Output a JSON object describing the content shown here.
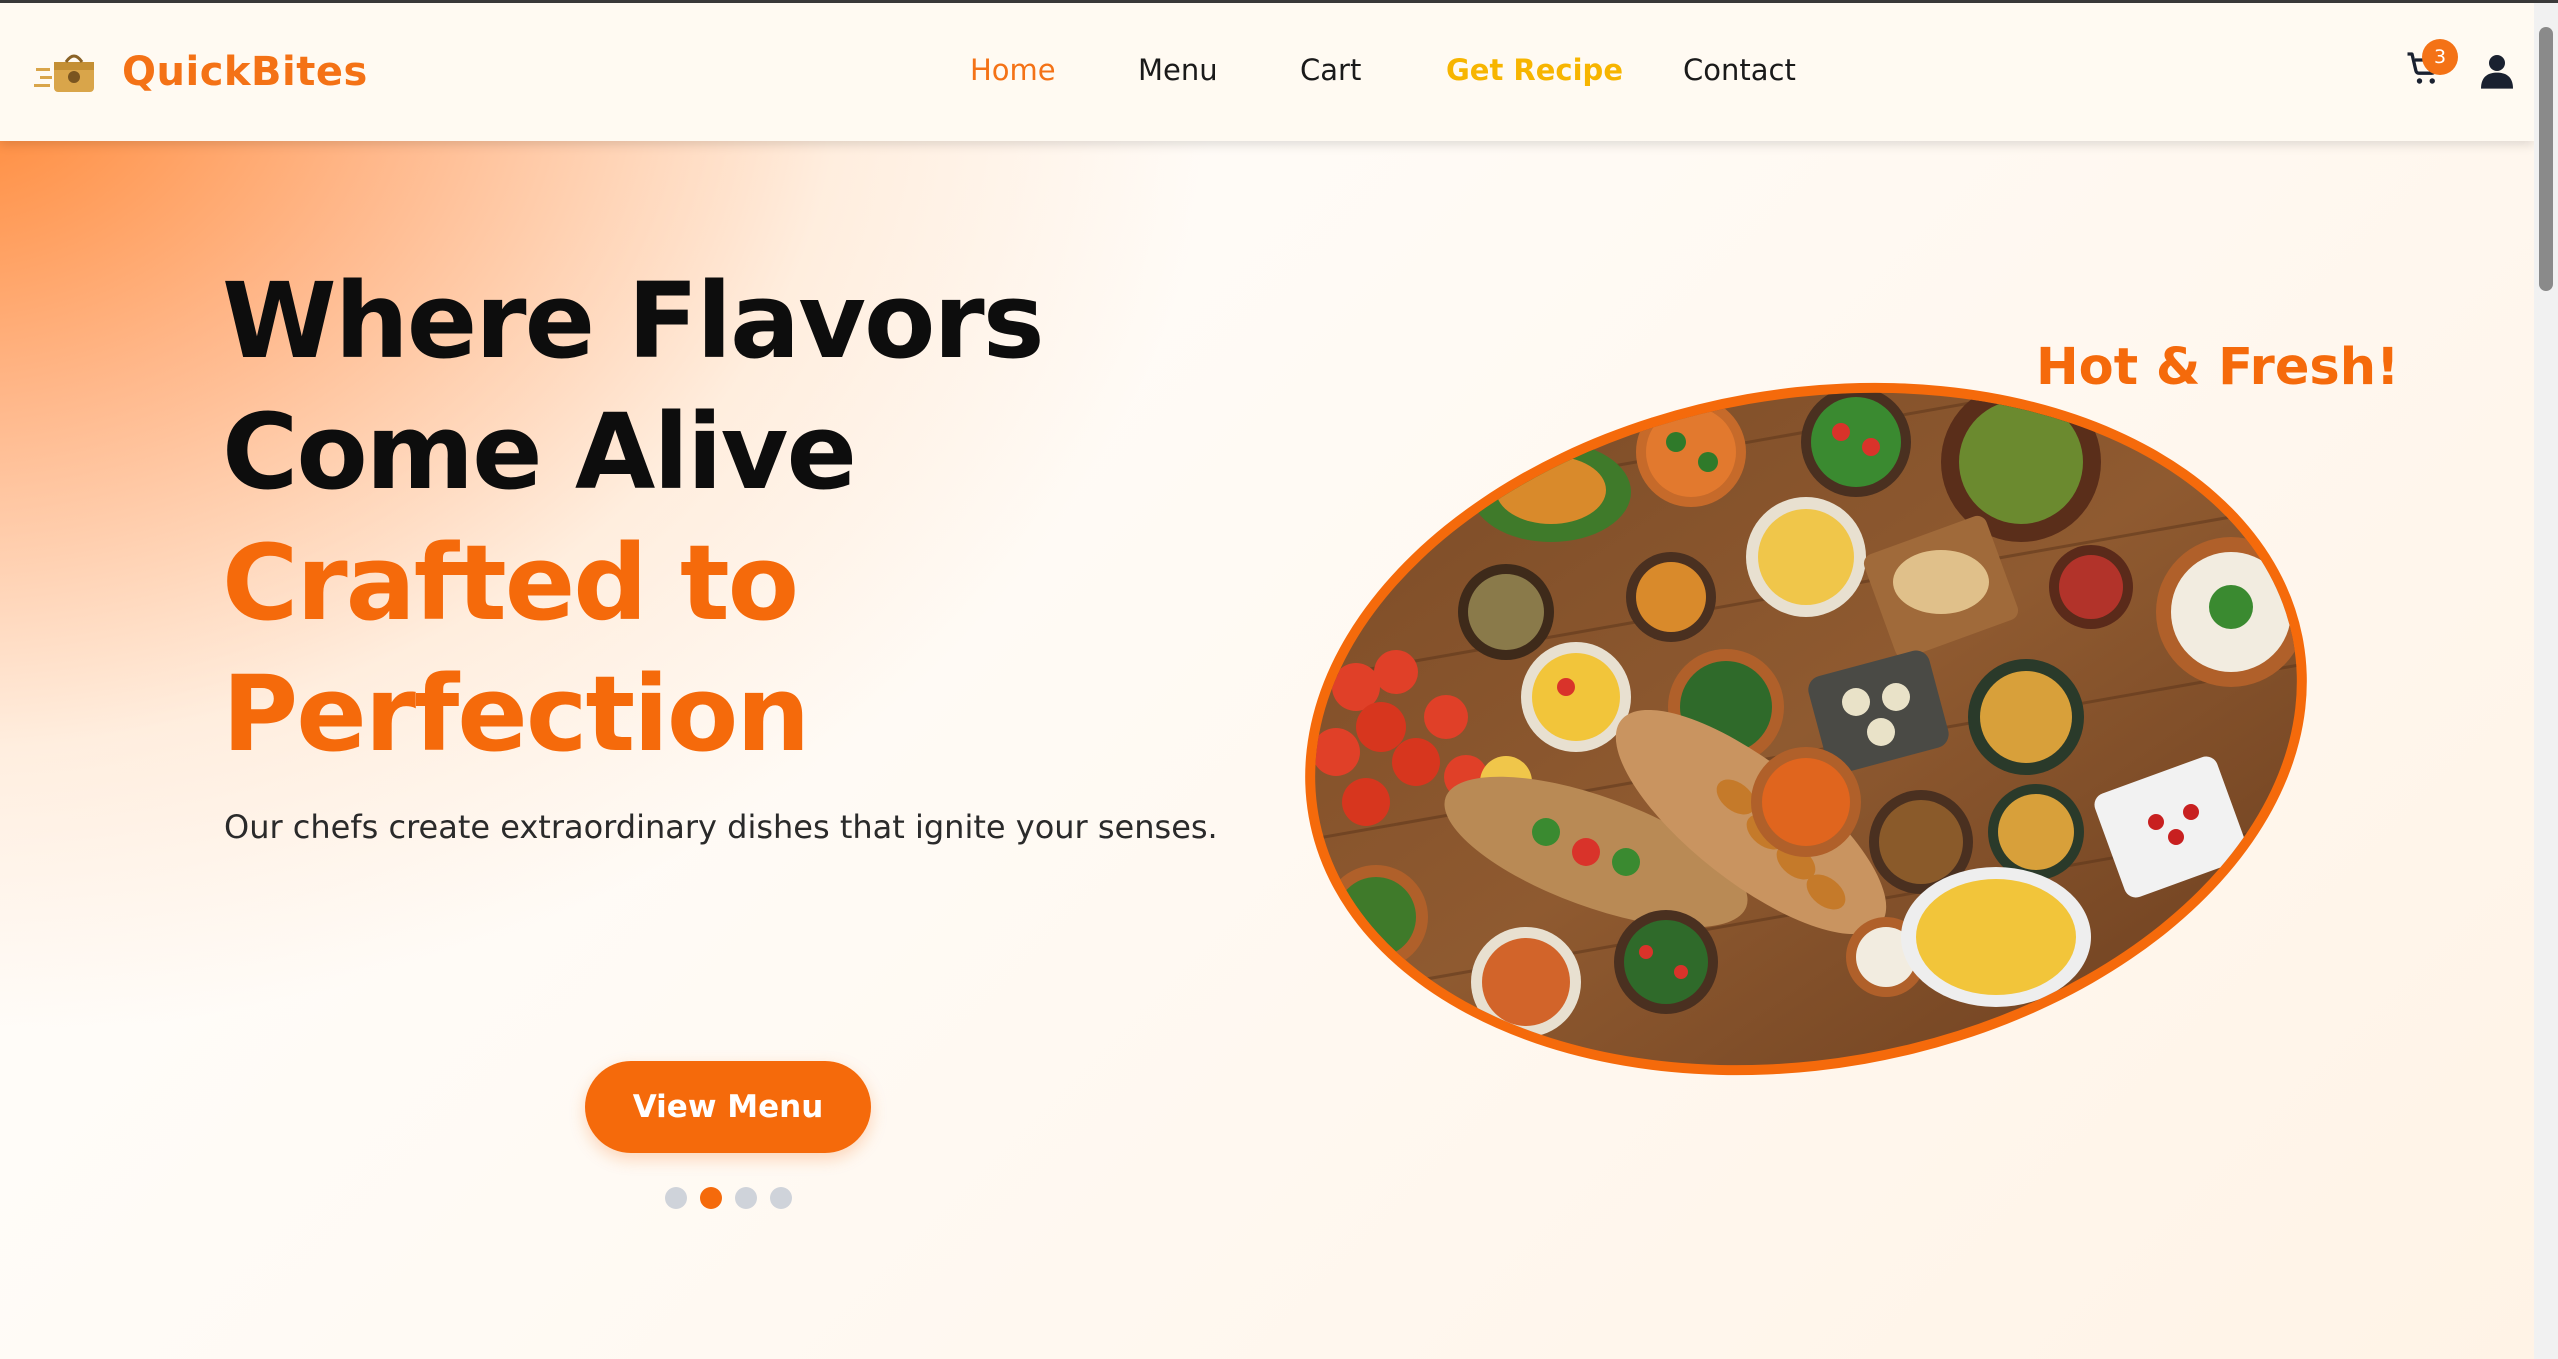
{
  "brand": {
    "name": "QuickBites",
    "accent_color": "#f47216"
  },
  "nav": {
    "links": [
      {
        "label": "Home",
        "state": "active"
      },
      {
        "label": "Menu"
      },
      {
        "label": "Cart"
      },
      {
        "label": "Get Recipe",
        "state": "highlight"
      },
      {
        "label": "Contact"
      }
    ],
    "cart": {
      "icon": "cart-icon",
      "badge_count": "3"
    },
    "user": {
      "icon": "user-icon"
    }
  },
  "hero": {
    "title_line1": "Where Flavors",
    "title_line2": "Come Alive",
    "title_line3": "Crafted to",
    "title_line4": "Perfection",
    "subtitle": "Our chefs create extraordinary dishes that ignite your senses.",
    "cta_label": "View Menu",
    "image_tag": "Hot & Fresh!",
    "carousel": {
      "total": 4,
      "active_index": 1
    }
  },
  "colors": {
    "primary": "#f56a0b",
    "highlight": "#f7b500",
    "text_dark": "#0d0d0d"
  }
}
